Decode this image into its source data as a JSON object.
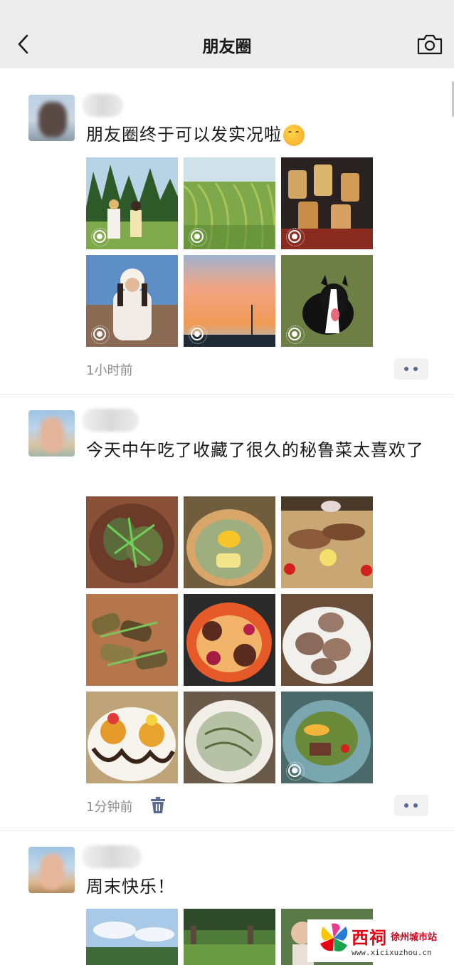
{
  "header": {
    "title": "朋友圈",
    "back_icon": "chevron-left-icon",
    "camera_icon": "camera-icon",
    "background": "#ededed"
  },
  "posts": [
    {
      "text": "朋友圈终于可以发实况啦",
      "emoji": "face-with-hand-over-mouth",
      "images": [
        {
          "name": "meadow-friends-photo",
          "live": true
        },
        {
          "name": "rice-field-photo",
          "live": true
        },
        {
          "name": "beer-cheers-photo",
          "live": true
        },
        {
          "name": "girl-portrait-photo",
          "live": true
        },
        {
          "name": "sunset-sky-photo",
          "live": true
        },
        {
          "name": "border-collie-photo",
          "live": true
        }
      ],
      "time": "1小时前",
      "has_delete": false
    },
    {
      "text": "今天中午吃了收藏了很久的秘鲁菜太喜欢了",
      "images": [
        {
          "name": "leaf-dish-photo",
          "live": false
        },
        {
          "name": "egg-pizza-photo",
          "live": false
        },
        {
          "name": "grilled-platter-photo",
          "live": false
        },
        {
          "name": "eggplant-rolls-photo",
          "live": false
        },
        {
          "name": "spaghetti-meatballs-photo",
          "live": false
        },
        {
          "name": "meat-rolls-photo",
          "live": false
        },
        {
          "name": "dessert-photo",
          "live": false
        },
        {
          "name": "creamy-pasta-photo",
          "live": false
        },
        {
          "name": "salad-plate-photo",
          "live": true
        }
      ],
      "time": "1分钟前",
      "has_delete": true
    },
    {
      "text": "周末快乐！",
      "images": [
        {
          "name": "sky-trees-photo",
          "live": false
        },
        {
          "name": "park-lawn-photo",
          "live": false
        },
        {
          "name": "garden-child-photo",
          "live": false
        }
      ]
    }
  ],
  "accent": "#576b95",
  "watermark": {
    "title": "西祠",
    "subtitle": "徐州城市站",
    "url": "www.xicixuzhou.cn"
  }
}
